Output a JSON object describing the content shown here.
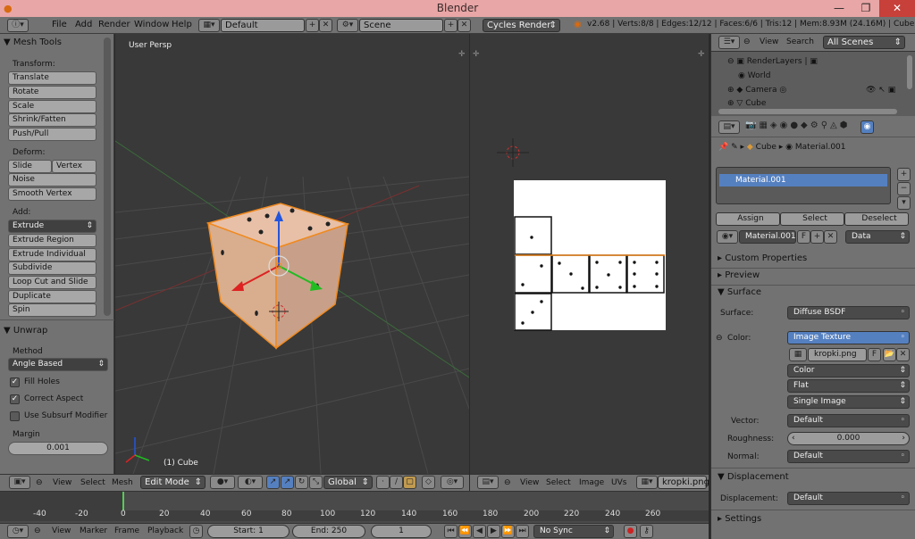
{
  "window": {
    "title": "Blender",
    "minimize": "—",
    "maximize": "❐",
    "close": "✕"
  },
  "menubar": {
    "items": [
      "File",
      "Add",
      "Render",
      "Window",
      "Help"
    ],
    "layout": "Default",
    "scene": "Scene",
    "engine": "Cycles Render",
    "stats": "v2.68 | Verts:8/8 | Edges:12/12 | Faces:6/6 | Tris:12 | Mem:8.93M (24.16M) | Cube"
  },
  "toolshelf": {
    "title": "Mesh Tools",
    "transform_label": "Transform:",
    "transform": [
      "Translate",
      "Rotate",
      "Scale",
      "Shrink/Fatten",
      "Push/Pull"
    ],
    "deform_label": "Deform:",
    "deform_row": [
      "Slide Edge",
      "Vertex"
    ],
    "deform": [
      "Noise",
      "Smooth Vertex"
    ],
    "add_label": "Add:",
    "add_select": "Extrude",
    "add": [
      "Extrude Region",
      "Extrude Individual",
      "Subdivide",
      "Loop Cut and Slide",
      "Duplicate",
      "Spin"
    ],
    "unwrap_title": "Unwrap",
    "method_label": "Method",
    "method_value": "Angle Based",
    "fill_holes": "Fill Holes",
    "correct_aspect": "Correct Aspect",
    "use_subsurf": "Use Subsurf Modifier",
    "margin_label": "Margin",
    "margin_value": "0.001"
  },
  "view3d": {
    "label": "User Persp",
    "object_label": "(1) Cube",
    "header": {
      "view": "View",
      "select": "Select",
      "mesh": "Mesh",
      "mode": "Edit Mode",
      "orientation": "Global"
    }
  },
  "uv_editor": {
    "header": {
      "view": "View",
      "select": "Select",
      "image": "Image",
      "uvs": "UVs",
      "image_name": "kropki.png"
    }
  },
  "outliner": {
    "header": {
      "view": "View",
      "search": "Search",
      "scenes": "All Scenes"
    },
    "rows": [
      "RenderLayers",
      "World",
      "Camera",
      "Cube"
    ]
  },
  "properties": {
    "breadcrumb": {
      "object": "Cube",
      "material": "Material.001"
    },
    "slot": "Material.001",
    "assign": "Assign",
    "select": "Select",
    "deselect": "Deselect",
    "material_name": "Material.001",
    "fake_user": "F",
    "link": "Data",
    "panels": {
      "custom_properties": "Custom Properties",
      "preview": "Preview",
      "surface": "Surface",
      "displacement": "Displacement",
      "settings": "Settings"
    },
    "surface_label": "Surface:",
    "surface_value": "Diffuse BSDF",
    "color_label": "Color:",
    "color_value": "Image Texture",
    "image_name": "kropki.png",
    "image_f": "F",
    "color_space": "Color",
    "projection": "Flat",
    "source": "Single Image",
    "vector_label": "Vector:",
    "vector_value": "Default",
    "roughness_label": "Roughness:",
    "roughness_value": "0.000",
    "normal_label": "Normal:",
    "normal_value": "Default",
    "displacement_label": "Displacement:",
    "displacement_value": "Default"
  },
  "timeline": {
    "ticks": [
      "-40",
      "-20",
      "0",
      "20",
      "40",
      "60",
      "80",
      "100",
      "120",
      "140",
      "160",
      "180",
      "200",
      "220",
      "240",
      "260"
    ],
    "view": "View",
    "marker": "Marker",
    "frame": "Frame",
    "playback": "Playback",
    "start": "Start: 1",
    "end": "End: 250",
    "current": "1",
    "sync": "No Sync"
  },
  "colors": {
    "accent": "#5580c0",
    "selection": "#e88a2a",
    "background": "#393939"
  }
}
